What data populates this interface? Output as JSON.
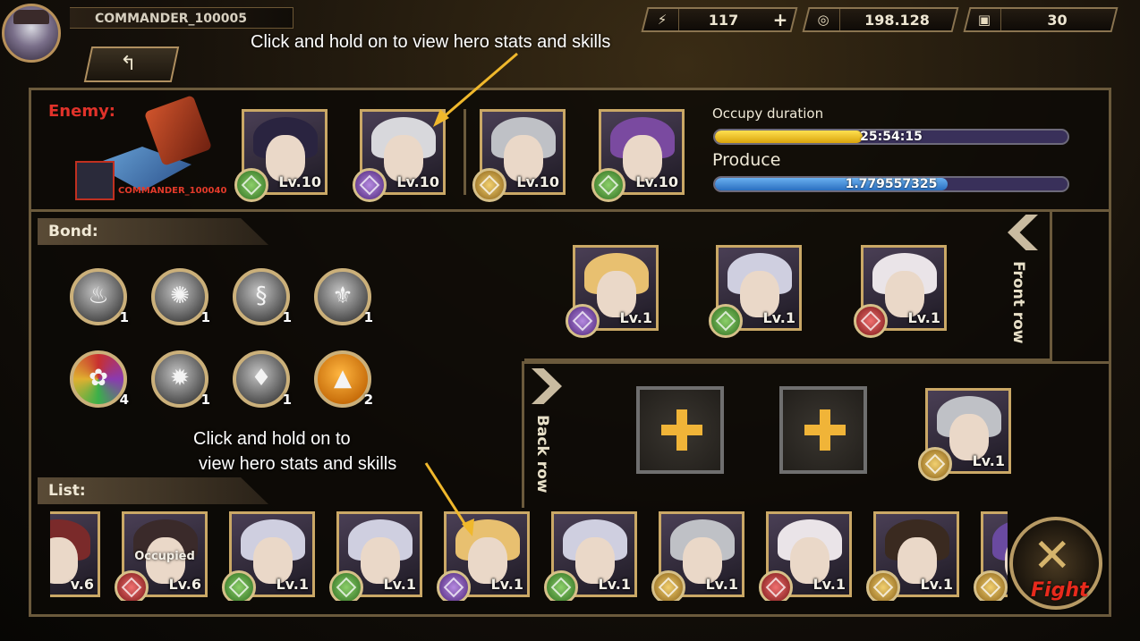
{
  "header": {
    "commander_name": "COMMANDER_100005",
    "back_icon": "back-arrow-icon"
  },
  "resources": {
    "energy": {
      "icon": "lightning-icon",
      "value": "117",
      "plus": "+"
    },
    "coins": {
      "icon": "coin-icon",
      "value": "198.128"
    },
    "tickets": {
      "icon": "ticket-icon",
      "value": "30"
    }
  },
  "callouts": {
    "top": "Click and hold on to view hero stats and skills",
    "bottom_line1": "Click and hold on to",
    "bottom_line2": "view hero stats and skills"
  },
  "enemy": {
    "label": "Enemy:",
    "commander": "COMMANDER_100040",
    "heroes": [
      {
        "level": "Lv.10",
        "emblem": "green",
        "hair": "#2a2440"
      },
      {
        "level": "Lv.10",
        "emblem": "purple",
        "hair": "#d8d8dc"
      },
      {
        "level": "Lv.10",
        "emblem": "gold",
        "hair": "#bfc1c6"
      },
      {
        "level": "Lv.10",
        "emblem": "green",
        "hair": "#7a4aa0"
      }
    ],
    "occupy_label": "Occupy duration",
    "occupy_value": "25:54:15",
    "occupy_fraction": 0.42,
    "produce_label": "Produce",
    "produce_value": "1.779557325",
    "produce_fraction": 0.66
  },
  "bond": {
    "label": "Bond:",
    "items": [
      {
        "icon": "flame-swirl-icon",
        "glyph": "♨",
        "count": "1",
        "tone": "grey"
      },
      {
        "icon": "gear-rune-icon",
        "glyph": "✺",
        "count": "1",
        "tone": "grey"
      },
      {
        "icon": "serpent-icon",
        "glyph": "§",
        "count": "1",
        "tone": "grey"
      },
      {
        "icon": "mask-icon",
        "glyph": "⚜",
        "count": "1",
        "tone": "grey"
      },
      {
        "icon": "all-elements-icon",
        "glyph": "✿",
        "count": "4",
        "tone": "multi"
      },
      {
        "icon": "vortex-icon",
        "glyph": "✹",
        "count": "1",
        "tone": "grey"
      },
      {
        "icon": "fire-icon",
        "glyph": "♦",
        "count": "1",
        "tone": "grey"
      },
      {
        "icon": "mountain-icon",
        "glyph": "▲",
        "count": "2",
        "tone": "orange"
      }
    ]
  },
  "formation": {
    "front_row_label": "Front row",
    "back_row_label": "Back row",
    "front": [
      {
        "level": "Lv.1",
        "emblem": "purple",
        "hair": "#e8c070"
      },
      {
        "level": "Lv.1",
        "emblem": "green",
        "hair": "#cfcfe0"
      },
      {
        "level": "Lv.1",
        "emblem": "red",
        "hair": "#eae4e8"
      }
    ],
    "back": [
      {
        "level": "Lv.1",
        "emblem": "gold",
        "hair": "#bfc1c6"
      }
    ]
  },
  "list": {
    "label": "List:",
    "items": [
      {
        "level": "v.6",
        "emblem": "red",
        "hair": "#7a2a2a",
        "occupied": ""
      },
      {
        "level": "Lv.6",
        "emblem": "red",
        "hair": "#3a2a2a",
        "occupied": "Occupied"
      },
      {
        "level": "Lv.1",
        "emblem": "green",
        "hair": "#cfcfe0",
        "occupied": ""
      },
      {
        "level": "Lv.1",
        "emblem": "green",
        "hair": "#cfcfe0",
        "occupied": ""
      },
      {
        "level": "Lv.1",
        "emblem": "purple",
        "hair": "#e8c070",
        "occupied": ""
      },
      {
        "level": "Lv.1",
        "emblem": "green",
        "hair": "#cfcfe0",
        "occupied": ""
      },
      {
        "level": "Lv.1",
        "emblem": "gold",
        "hair": "#bfc1c6",
        "occupied": ""
      },
      {
        "level": "Lv.1",
        "emblem": "red",
        "hair": "#eae4e8",
        "occupied": ""
      },
      {
        "level": "Lv.1",
        "emblem": "gold",
        "hair": "#3a2a20",
        "occupied": ""
      },
      {
        "level": "",
        "emblem": "gold",
        "hair": "#6a4aa0",
        "occupied": ""
      }
    ]
  },
  "fight": {
    "label": "Fight",
    "icon": "crossed-swords-icon"
  },
  "colors": {
    "accent_gold": "#caa866",
    "enemy_red": "#e0322a",
    "occupy_bar": "#f2c21a",
    "produce_bar": "#3d8fe0"
  }
}
